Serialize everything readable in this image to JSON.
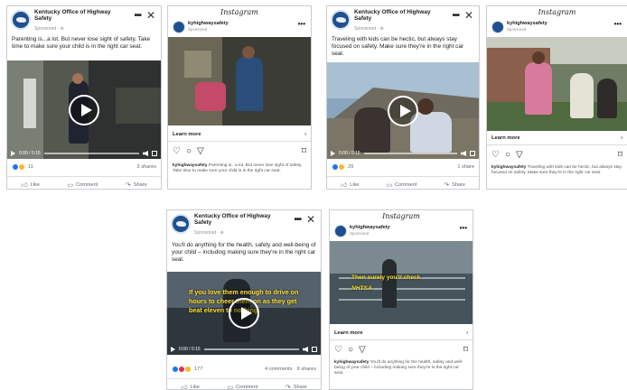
{
  "facebook": {
    "page_name": "Kentucky Office of Highway Safety",
    "sponsored": "Sponsored · ⊕",
    "more": "•••",
    "close": "✕",
    "like": "Like",
    "comment": "Comment",
    "share": "Share"
  },
  "instagram": {
    "brand": "Instagram",
    "handle": "kyhighwaysafety",
    "sponsored": "Sponsored",
    "more": "•••",
    "learn_more": "Learn more",
    "chevron": "›"
  },
  "ads": {
    "fb1": {
      "text": "Parenting is...a lot. But never lose sight of safety. Take time to make sure your child is in the right car seat.",
      "time": "0:00 / 0:15",
      "reactions": "11",
      "shares": "3 shares"
    },
    "ig1": {
      "caption_user": "kyhighwaysafety",
      "caption": "Parenting is...a lot. But never lose sight of safety. Take time to make sure your child is in the right car seat."
    },
    "fb2": {
      "text": "Traveling with kids can be hectic, but always stay focused on safety. Make sure they're in the right car seat.",
      "time": "0:00 / 0:15",
      "reactions": "29",
      "shares": "1 share"
    },
    "ig2": {
      "caption_user": "kyhighwaysafety",
      "caption": "Traveling with kids can be hectic, but always stay focused on safety. Make sure they're in the right car seat."
    },
    "fb3": {
      "text": "You'll do anything for the health, safety and well-being of your child – including making sure they're in the right car seat.",
      "overlay": "If you love them enough to drive on hours to cheer them on as they get beat eleven to nothing",
      "time": "0:00 / 0:15",
      "reactions": "177",
      "comments": "4 comments",
      "shares": "9 shares"
    },
    "ig3": {
      "caption_user": "kyhighwaysafety",
      "caption": "You'll do anything for the health, safety and well-being of your child – including making sure they're in the right car seat.",
      "overlay_line1": "Then surely you'll check",
      "overlay_line2": "NHTSA"
    }
  },
  "colors": {
    "fb_blue": "#1877f2",
    "logo_navy": "#1f4f8f",
    "overlay_yellow": "#ffe033"
  },
  "icons": [
    "play-icon",
    "heart-icon",
    "comment-icon",
    "send-icon",
    "bookmark-icon",
    "like-icon",
    "share-icon"
  ]
}
